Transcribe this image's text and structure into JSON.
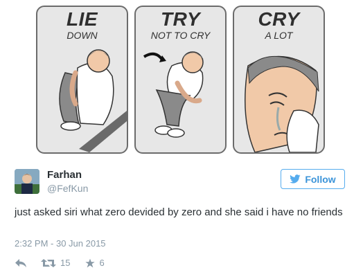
{
  "comic": {
    "panels": [
      {
        "big": "LIE",
        "small": "DOWN"
      },
      {
        "big": "TRY",
        "small": "NOT TO CRY"
      },
      {
        "big": "CRY",
        "small": "A LOT"
      }
    ]
  },
  "tweet": {
    "name": "Farhan",
    "handle": "@FefKun",
    "follow_label": "Follow",
    "text": "just asked siri what zero devided by zero and she said i have no friends",
    "timestamp": "2:32 PM - 30 Jun 2015",
    "retweets": "15",
    "favorites": "6",
    "colors": {
      "accent": "#55acee",
      "text": "#292f33",
      "muted": "#8899a6"
    }
  }
}
